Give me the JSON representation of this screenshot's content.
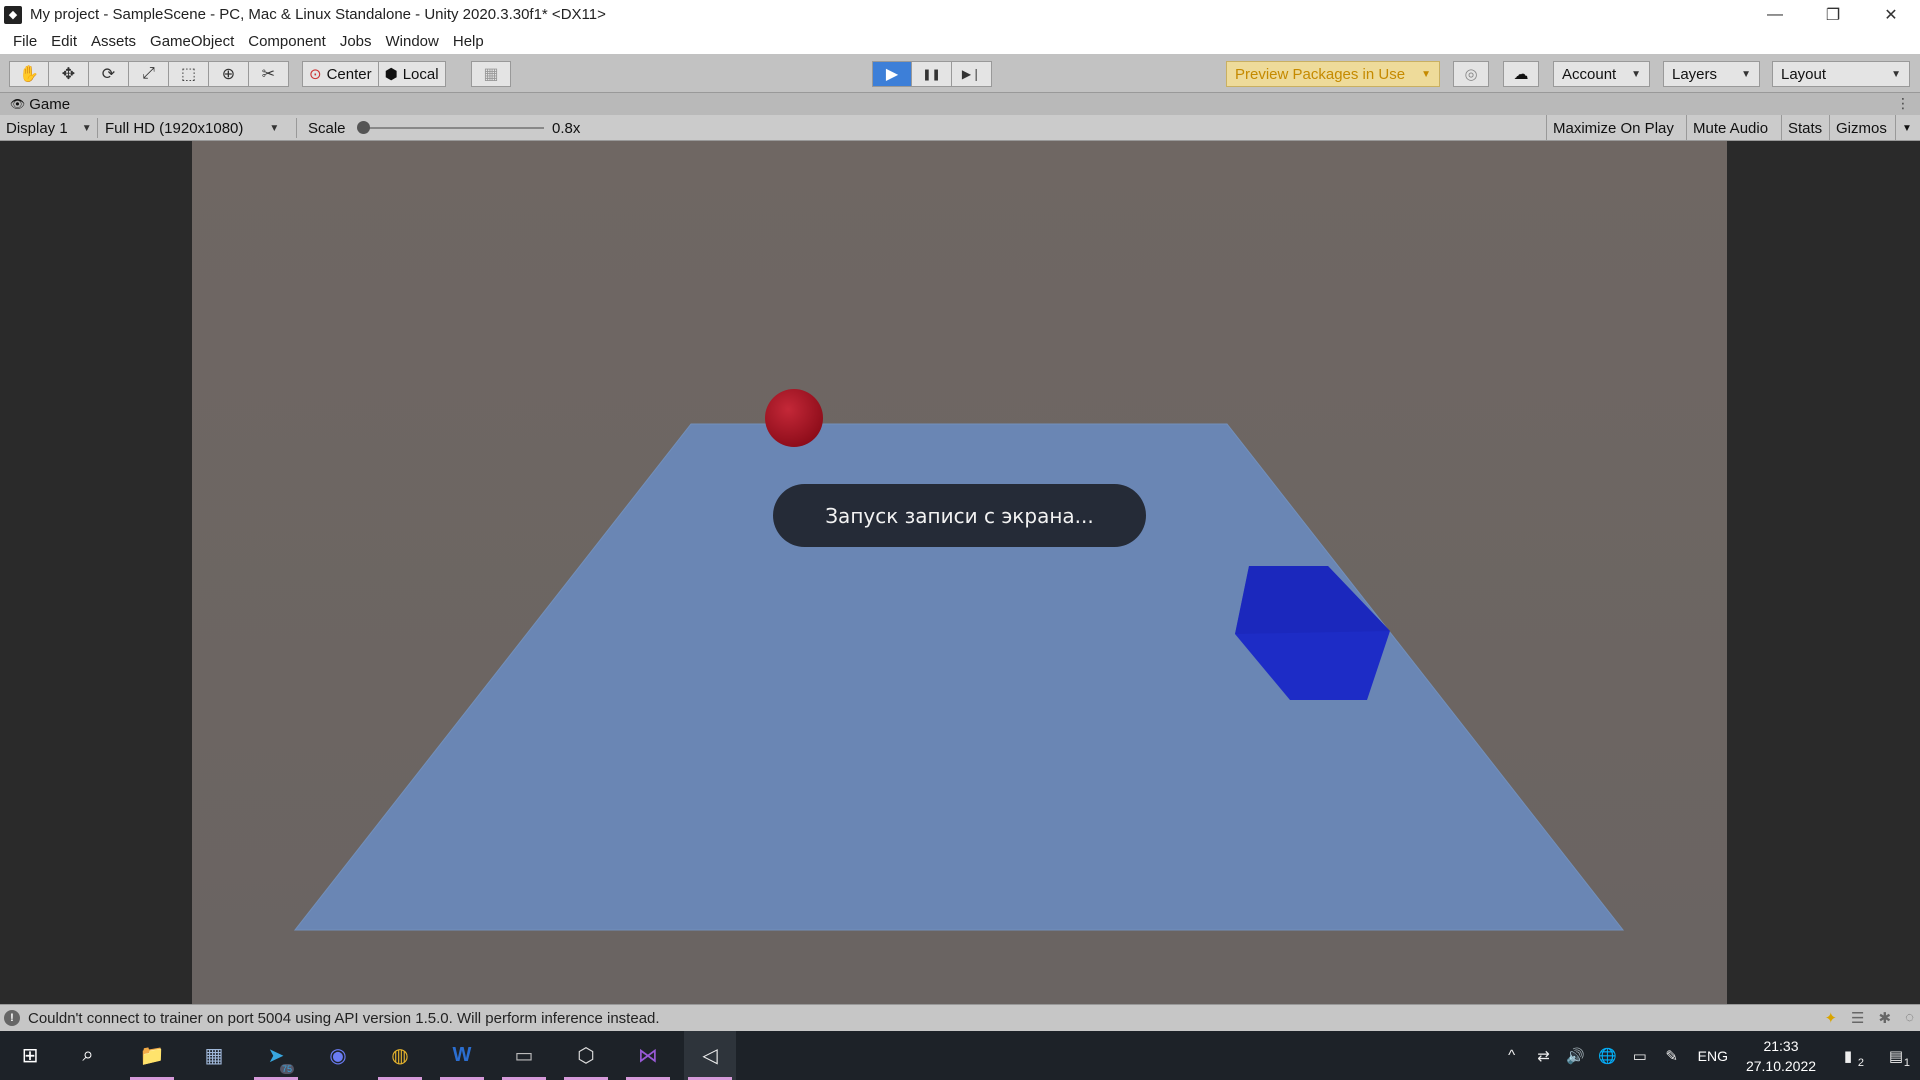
{
  "window": {
    "title": "My project - SampleScene - PC, Mac & Linux Standalone - Unity 2020.3.30f1* <DX11>",
    "controls": {
      "minimize": "—",
      "restore": "❐",
      "close": "✕"
    }
  },
  "menu": [
    "File",
    "Edit",
    "Assets",
    "GameObject",
    "Component",
    "Jobs",
    "Window",
    "Help"
  ],
  "toolbar": {
    "tools": [
      {
        "name": "hand-tool",
        "glyph": "✋"
      },
      {
        "name": "move-tool",
        "glyph": "✥"
      },
      {
        "name": "rotate-tool",
        "glyph": "⟳"
      },
      {
        "name": "scale-tool",
        "glyph": "⤢"
      },
      {
        "name": "rect-tool",
        "glyph": "⬚"
      },
      {
        "name": "transform-tool",
        "glyph": "⊕"
      },
      {
        "name": "custom-tool",
        "glyph": "✂"
      }
    ],
    "pivot_label": "Center",
    "space_label": "Local",
    "snap_glyph": "▦",
    "play_glyph": "▶",
    "pause_glyph": "❚❚",
    "step_glyph": "▶❘",
    "preview_packages": "Preview Packages in Use",
    "collab_glyph": "◎",
    "cloud_glyph": "☁",
    "account": "Account",
    "layers": "Layers",
    "layout": "Layout",
    "caret": "▼"
  },
  "game_tab": {
    "label": "Game",
    "icon": "eye-icon",
    "glyph": "👁",
    "more": "⋮"
  },
  "game_bar": {
    "display": "Display 1",
    "resolution": "Full HD (1920x1080)",
    "scale_label": "Scale",
    "scale_value": "0.8x",
    "maximize": "Maximize On Play",
    "mute": "Mute Audio",
    "stats": "Stats",
    "gizmos": "Gizmos"
  },
  "scene": {
    "toast": "Запуск записи с экрана...",
    "colors": {
      "plane": "#6a86b4",
      "sphere": "#a3101f",
      "cube": "#1d2cc6",
      "background": "#6e6662"
    }
  },
  "status": {
    "message": "Couldn't connect to trainer on port 5004 using API version 1.5.0. Will perform inference instead.",
    "icon": "!"
  },
  "taskbar": {
    "apps": [
      {
        "name": "start-button",
        "glyph": "⊞"
      },
      {
        "name": "search-icon",
        "glyph": "⌕"
      },
      {
        "name": "file-explorer-icon",
        "glyph": "📁"
      },
      {
        "name": "calculator-icon",
        "glyph": "▦"
      },
      {
        "name": "telegram-icon",
        "glyph": "➤"
      },
      {
        "name": "discord-icon",
        "glyph": "◉"
      },
      {
        "name": "chrome-icon",
        "glyph": "◍"
      },
      {
        "name": "word-icon",
        "glyph": "W"
      },
      {
        "name": "terminal-icon",
        "glyph": "▭"
      },
      {
        "name": "unity-hub-icon",
        "glyph": "⬡"
      },
      {
        "name": "visual-studio-icon",
        "glyph": "⋈"
      },
      {
        "name": "unity-editor-icon",
        "glyph": "◁"
      }
    ],
    "telegram_badge": "75",
    "tray": [
      "^",
      "⇄",
      "🔊",
      "🌐",
      "▭",
      "✎"
    ],
    "lang": "ENG",
    "time": "21:33",
    "date": "27.10.2022",
    "notify_badge": "2",
    "action_center_badge": "1"
  }
}
